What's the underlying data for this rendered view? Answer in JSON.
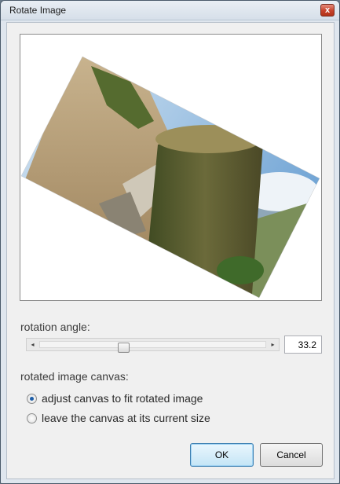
{
  "window": {
    "title": "Rotate Image",
    "close_glyph": "x"
  },
  "preview": {
    "rotation_deg": 33.2,
    "alt": "rotated photo preview"
  },
  "rotation": {
    "label": "rotation angle:",
    "value_text": "33.2",
    "value": 33.2,
    "min": 0,
    "max": 90,
    "left_arrow": "◂",
    "right_arrow": "▸"
  },
  "canvas": {
    "label": "rotated image canvas:",
    "options": [
      {
        "label": "adjust canvas to fit rotated image",
        "checked": true
      },
      {
        "label": "leave the canvas at its current size",
        "checked": false
      }
    ]
  },
  "buttons": {
    "ok": "OK",
    "cancel": "Cancel"
  },
  "colors": {
    "accent": "#1e5ea8",
    "close": "#c6412a"
  }
}
